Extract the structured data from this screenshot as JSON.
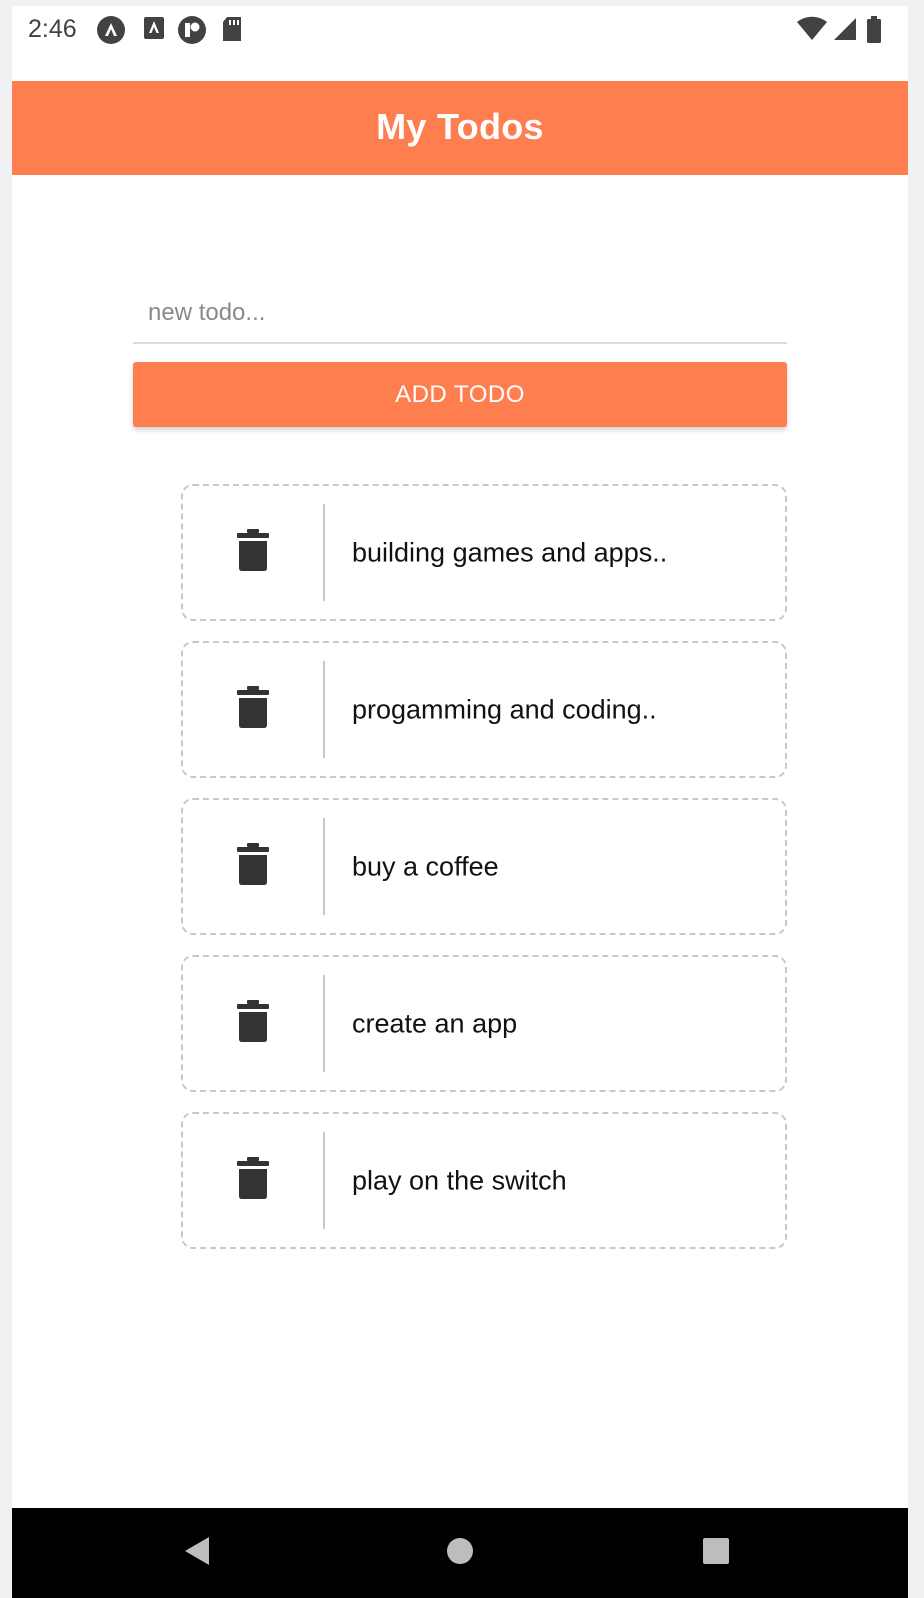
{
  "status_bar": {
    "time": "2:46",
    "left_icons": [
      "notification-a-icon",
      "accessibility-icon",
      "app-notification-icon",
      "sd-card-icon"
    ],
    "right_icons": [
      "wifi-icon",
      "signal-icon",
      "battery-icon"
    ]
  },
  "header": {
    "title": "My Todos",
    "color": "#ff7e4f"
  },
  "input": {
    "value": "",
    "placeholder": "new todo..."
  },
  "add_button": {
    "label": "ADD TODO"
  },
  "todos": [
    {
      "text": "building games and apps..",
      "icon": "trash-icon"
    },
    {
      "text": "progamming and coding..",
      "icon": "trash-icon"
    },
    {
      "text": "buy a coffee",
      "icon": "trash-icon"
    },
    {
      "text": "create an app",
      "icon": "trash-icon"
    },
    {
      "text": "play on the switch",
      "icon": "trash-icon"
    }
  ],
  "nav_bar": {
    "buttons": [
      "back-icon",
      "home-icon",
      "recents-icon"
    ]
  }
}
